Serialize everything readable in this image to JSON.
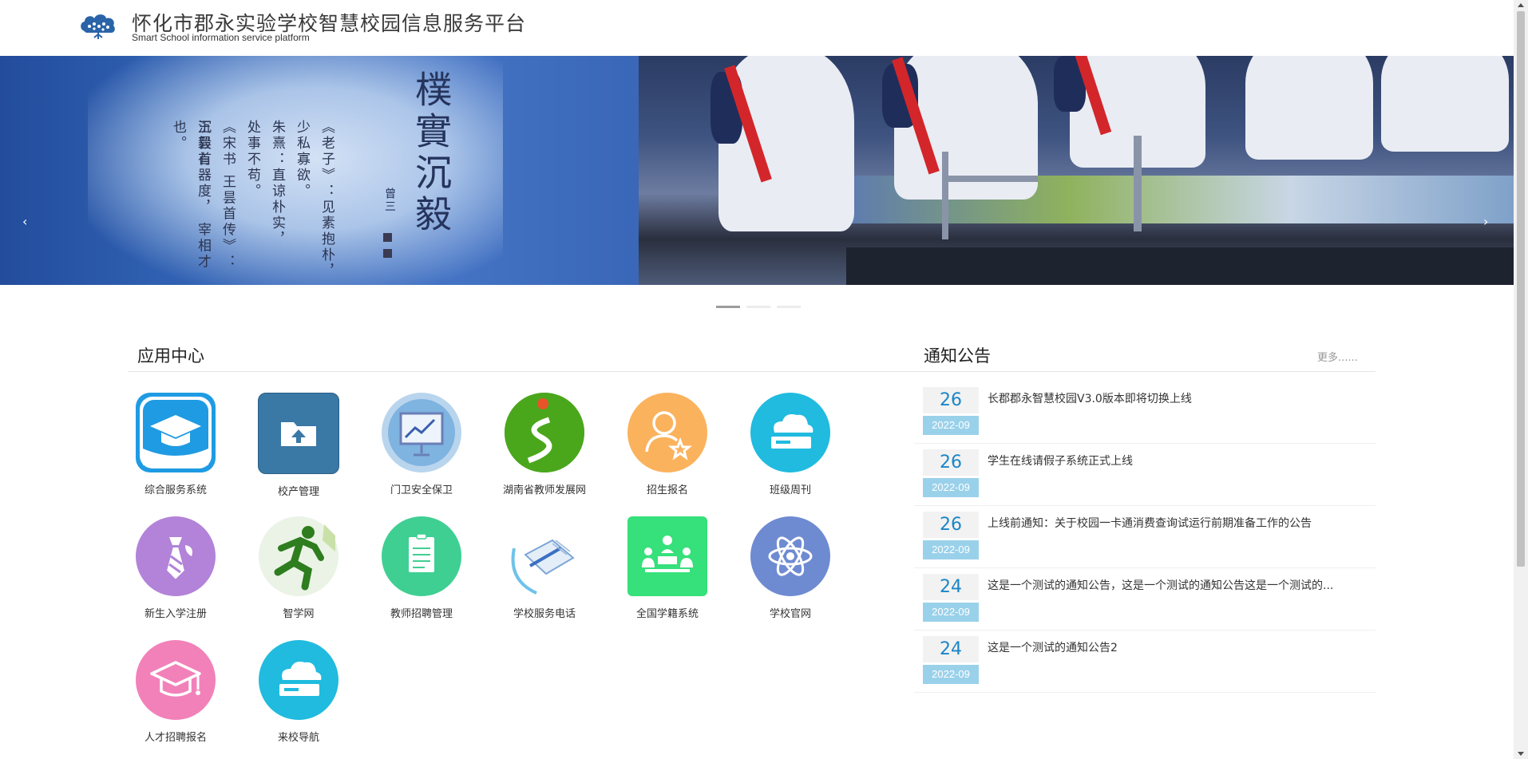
{
  "header": {
    "title": "怀化市郡永实验学校智慧校园信息服务平台",
    "subtitle": "Smart School information service platform"
  },
  "banner": {
    "calligraphy": "樸實沉毅",
    "calligraphy_sign": "曾三",
    "poem_lines": [
      "《老子》：见素抱朴，",
      "少私寡欲。",
      "朱熹：直谅朴实，",
      "处事不苟。",
      "《宋书 王昙首传》：",
      "王昙首",
      "沉毅有器度， 宰相才也。"
    ],
    "prev_label": "‹",
    "next_label": "›",
    "slide_count": 3,
    "active_slide": 1
  },
  "apps": {
    "title": "应用中心",
    "items": [
      {
        "label": "综合服务系统",
        "icon": "graduation-cap-icon",
        "color": "#1f9be3"
      },
      {
        "label": "校产管理",
        "icon": "folder-upload-icon",
        "color": "#3a78a6"
      },
      {
        "label": "门卫安全保卫",
        "icon": "presentation-chart-icon",
        "color": "#a9cbe8"
      },
      {
        "label": "湖南省教师发展网",
        "icon": "road-path-icon",
        "color": "#4aa71c"
      },
      {
        "label": "招生报名",
        "icon": "user-star-icon",
        "color": "#fbb25d"
      },
      {
        "label": "班级周刊",
        "icon": "cloud-server-icon",
        "color": "#20bbdf"
      },
      {
        "label": "新生入学注册",
        "icon": "necktie-icon",
        "color": "#b283d8"
      },
      {
        "label": "智学网",
        "icon": "runner-icon",
        "color": "#e9f3e4"
      },
      {
        "label": "教师招聘管理",
        "icon": "document-icon",
        "color": "#3fcf93"
      },
      {
        "label": "学校服务电话",
        "icon": "book-pen-icon",
        "color": "#d7eaf6"
      },
      {
        "label": "全国学籍系统",
        "icon": "meeting-icon",
        "color": "#36e07a"
      },
      {
        "label": "学校官网",
        "icon": "atom-icon",
        "color": "#6e8bd1"
      },
      {
        "label": "人才招聘报名",
        "icon": "graduation-cap-icon",
        "color": "#f281b9"
      },
      {
        "label": "来校导航",
        "icon": "cloud-server-icon",
        "color": "#20bbdf"
      }
    ]
  },
  "notices": {
    "title": "通知公告",
    "more_label": "更多......",
    "items": [
      {
        "day": "26",
        "month": "2022-09",
        "title": "长郡郡永智慧校园V3.0版本即将切换上线"
      },
      {
        "day": "26",
        "month": "2022-09",
        "title": "学生在线请假子系统正式上线"
      },
      {
        "day": "26",
        "month": "2022-09",
        "title": "上线前通知：关于校园一卡通消费查询试运行前期准备工作的公告"
      },
      {
        "day": "24",
        "month": "2022-09",
        "title": "这是一个测试的通知公告，这是一个测试的通知公告这是一个测试的..."
      },
      {
        "day": "24",
        "month": "2022-09",
        "title": "这是一个测试的通知公告2"
      }
    ]
  },
  "colors": {
    "accent": "#1a86c8",
    "month_badge": "#9ad1ea",
    "banner_blue": "#2f5fb0"
  }
}
